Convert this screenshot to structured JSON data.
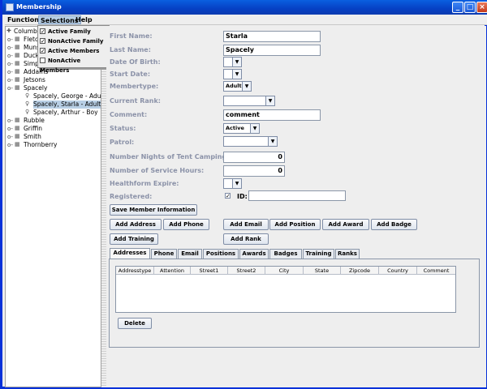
{
  "window": {
    "title": "Membership"
  },
  "menubar": {
    "items": [
      "Functions",
      "Selections",
      "Help"
    ]
  },
  "selections_menu": {
    "items": [
      {
        "label": "Active Family",
        "checked": true
      },
      {
        "label": "NonActive Family",
        "checked": true
      },
      {
        "label": "Active Members",
        "checked": true
      },
      {
        "label": "NonActive Members",
        "checked": false
      }
    ]
  },
  "tree": {
    "root": "Columbus",
    "families": [
      "Fletc",
      "Muns",
      "Duck",
      "Simp",
      "Addams",
      "Jetsons",
      "Spacely",
      "Rubble",
      "Griffin",
      "Smith",
      "Thornberry"
    ],
    "members": [
      "Spacely, George  - Adult",
      "Spacely, Starla  - Adult",
      "Spacely, Arthur  - Boy"
    ]
  },
  "form": {
    "labels": {
      "first_name": "First Name:",
      "last_name": "Last Name:",
      "dob": "Date Of Birth:",
      "start_date": "Start Date:",
      "membertype": "Membertype:",
      "current_rank": "Current Rank:",
      "comment": "Comment:",
      "status": "Status:",
      "patrol": "Patrol:",
      "nights": "Number Nights of Tent Camping:",
      "service_hours": "Number of Service Hours:",
      "healthform": "Healthform Expire:",
      "registered": "Registered:",
      "id": "ID:"
    },
    "values": {
      "first_name": "Starla",
      "last_name": "Spacely",
      "membertype": "Adult",
      "comment": "comment",
      "status": "Active",
      "nights": "0",
      "service_hours": "0",
      "registered": true
    }
  },
  "buttons": {
    "save_member": "Save Member Information",
    "add_address": "Add Address",
    "add_phone": "Add Phone",
    "add_email": "Add Email",
    "add_position": "Add Position",
    "add_award": "Add Award",
    "add_badge": "Add Badge",
    "add_training": "Add Training",
    "add_rank": "Add Rank",
    "delete": "Delete"
  },
  "tabs": [
    "Addresses",
    "Phone",
    "Email",
    "Positions",
    "Awards",
    "Badges",
    "Training",
    "Ranks"
  ],
  "address_table": {
    "columns": [
      "Addresstype",
      "Attention",
      "Street1",
      "Street2",
      "City",
      "State",
      "Zipcode",
      "Country",
      "Comment"
    ]
  }
}
